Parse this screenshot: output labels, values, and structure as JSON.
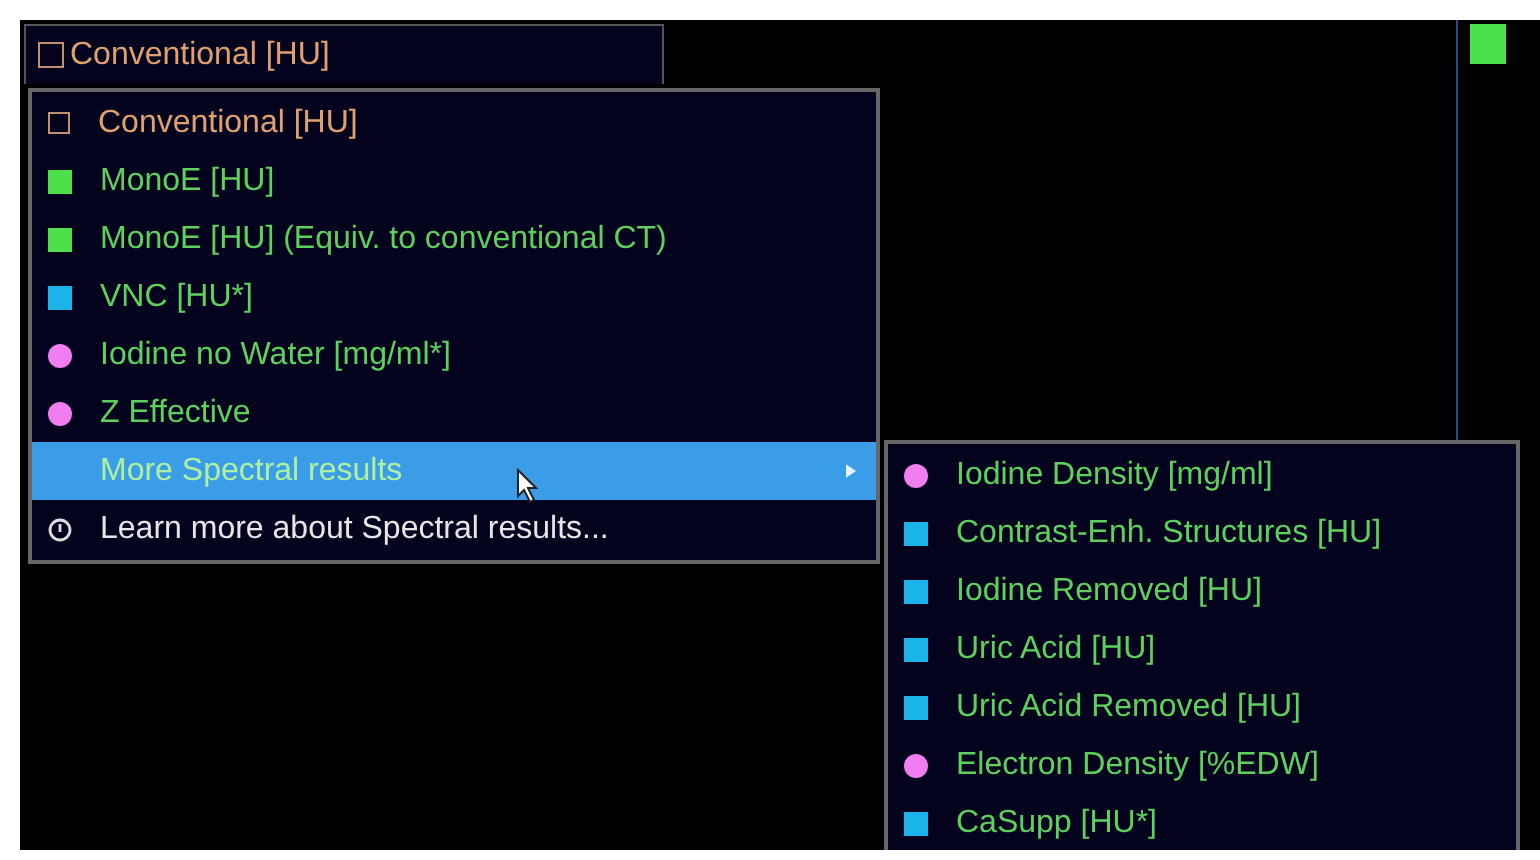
{
  "dropdown": {
    "label": "Conventional [HU]"
  },
  "menu": [
    {
      "kind": "outline",
      "label": "Conventional [HU]",
      "selected": false
    },
    {
      "kind": "square",
      "color": "#4de04d",
      "label": "MonoE [HU]",
      "selected": false
    },
    {
      "kind": "square",
      "color": "#4de04d",
      "label": "MonoE [HU] (Equiv. to conventional CT)",
      "selected": false
    },
    {
      "kind": "square",
      "color": "#1ab4ea",
      "label": "VNC [HU*]",
      "selected": false
    },
    {
      "kind": "circle",
      "color": "#f07ef0",
      "label": "Iodine no Water [mg/ml*]",
      "selected": false
    },
    {
      "kind": "circle",
      "color": "#f07ef0",
      "label": "Z Effective",
      "selected": false
    },
    {
      "kind": "submenu",
      "label": "More Spectral results",
      "selected": true
    },
    {
      "kind": "info",
      "label": "Learn more about Spectral results...",
      "selected": false
    }
  ],
  "submenu": [
    {
      "kind": "circle",
      "color": "#f07ef0",
      "label": "Iodine Density [mg/ml]"
    },
    {
      "kind": "square",
      "color": "#1ab4ea",
      "label": "Contrast-Enh. Structures [HU]"
    },
    {
      "kind": "square",
      "color": "#1ab4ea",
      "label": "Iodine Removed [HU]"
    },
    {
      "kind": "square",
      "color": "#1ab4ea",
      "label": "Uric Acid [HU]"
    },
    {
      "kind": "square",
      "color": "#1ab4ea",
      "label": "Uric Acid Removed [HU]"
    },
    {
      "kind": "circle",
      "color": "#f07ef0",
      "label": "Electron Density [%EDW]"
    },
    {
      "kind": "square",
      "color": "#1ab4ea",
      "label": "CaSupp [HU*]"
    }
  ]
}
